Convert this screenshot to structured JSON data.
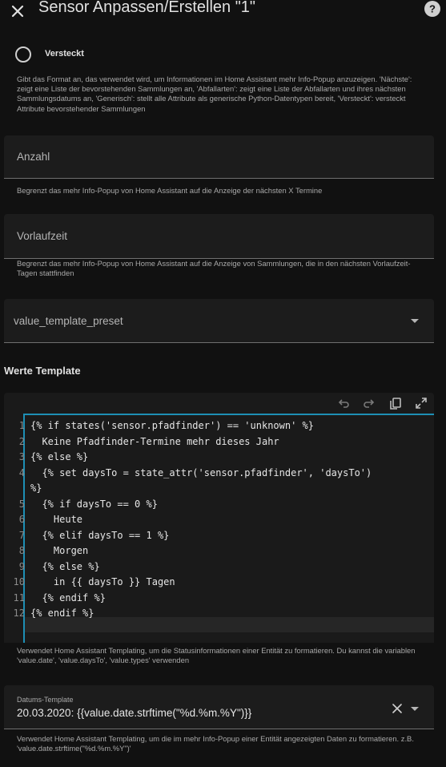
{
  "header": {
    "title": "Sensor Anpassen/Erstellen \"1\""
  },
  "format": {
    "radio_label": "Versteckt",
    "radio_selected": false,
    "help": "Gibt das Format an, das verwendet wird, um Informationen im Home Assistant mehr Info-Popup anzuzeigen. 'Nächste': zeigt eine Liste der bevorstehenden Sammlungen an, 'Abfallarten': zeigt eine Liste der Abfallarten und ihres nächsten Sammlungsdatums an, 'Generisch': stellt alle Attribute als generische Python-Datentypen bereit, 'Versteckt': versteckt Attribute bevorstehender Sammlungen"
  },
  "anzahl": {
    "label": "Anzahl",
    "value": "",
    "help": "Begrenzt das mehr Info-Popup von Home Assistant auf die Anzeige der nächsten X Termine"
  },
  "vorlaufzeit": {
    "label": "Vorlaufzeit",
    "value": "",
    "help": "Begrenzt das mehr Info-Popup von Home Assistant auf die Anzeige von Sammlungen, die in den nächsten Vorlaufzeit-Tagen stattfinden"
  },
  "preset": {
    "label": "value_template_preset",
    "value": ""
  },
  "template": {
    "section_title": "Werte Template",
    "lines": [
      {
        "num": "1",
        "code": "{% if states('sensor.pfadfinder') == 'unknown' %}"
      },
      {
        "num": "2",
        "code": "  Keine Pfadfinder-Termine mehr dieses Jahr"
      },
      {
        "num": "3",
        "code": "{% else %}"
      },
      {
        "num": "4",
        "code": "  {% set daysTo = state_attr('sensor.pfadfinder', 'daysTo')"
      },
      {
        "num": "",
        "code": "%}"
      },
      {
        "num": "5",
        "code": "  {% if daysTo == 0 %}"
      },
      {
        "num": "6",
        "code": "    Heute"
      },
      {
        "num": "7",
        "code": "  {% elif daysTo == 1 %}"
      },
      {
        "num": "8",
        "code": "    Morgen"
      },
      {
        "num": "9",
        "code": "  {% else %}"
      },
      {
        "num": "10",
        "code": "    in {{ daysTo }} Tagen"
      },
      {
        "num": "11",
        "code": "  {% endif %}"
      },
      {
        "num": "12",
        "code": "{% endif %}"
      }
    ],
    "help": "Verwendet Home Assistant Templating, um die Statusinformationen einer Entität zu formatieren. Du kannst die variablen 'value.date', 'value.daysTo', 'value.types' verwenden"
  },
  "date_template": {
    "label": "Datums-Template",
    "value": "20.03.2020: {{value.date.strftime(\"%d.%m.%Y\")}}",
    "help": "Verwendet Home Assistant Templating, um die im mehr Info-Popup einer Entität angezeigten Daten zu formatieren. z.B. 'value.date.strftime(\"%d.%m.%Y\")'"
  },
  "icons": {
    "close": "close-icon",
    "help": "help-circle-icon",
    "undo": "undo-icon",
    "redo": "redo-icon",
    "copy": "copy-icon",
    "fullscreen": "fullscreen-icon",
    "dropdown": "chevron-down-icon",
    "clear": "clear-icon"
  },
  "colors": {
    "background": "#111111",
    "field": "#1c1c1c",
    "accent": "#1e8fb5"
  }
}
